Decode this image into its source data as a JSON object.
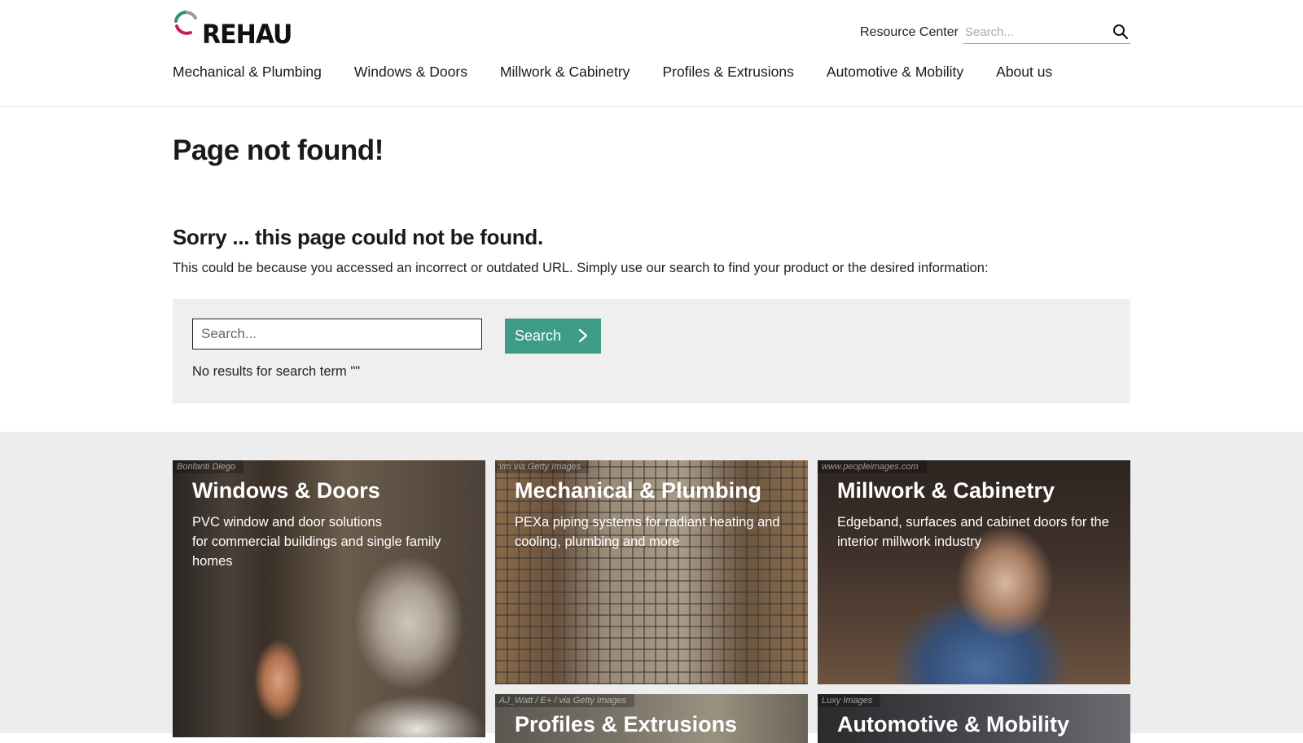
{
  "brand": {
    "name": "REHAU"
  },
  "header": {
    "resource_link": "Resource Center",
    "search_placeholder": "Search...",
    "nav": [
      "Mechanical & Plumbing",
      "Windows & Doors",
      "Millwork & Cabinetry",
      "Profiles & Extrusions",
      "Automotive & Mobility",
      "About us"
    ]
  },
  "main": {
    "title": "Page not found!",
    "sorry_heading": "Sorry ... this page could not be found.",
    "description": "This could be because you accessed an incorrect or outdated URL. Simply use our search to find your product or the desired information:",
    "search": {
      "placeholder": "Search...",
      "button_label": "Search",
      "no_results": "No results for search term \"\""
    }
  },
  "cards": [
    {
      "title": "Windows & Doors",
      "text": "PVC window and door solutions\nfor commercial buildings and single family homes",
      "credit": "Bonfanti Diego"
    },
    {
      "title": "Mechanical & Plumbing",
      "text": "PEXa piping systems for radiant heating and cooling, plumbing and more",
      "credit": "vm via Getty Images"
    },
    {
      "title": "Millwork & Cabinetry",
      "text": "Edgeband, surfaces and cabinet doors for the interior millwork industry",
      "credit": "www.peopleimages.com"
    },
    {
      "title": "Profiles & Extrusions",
      "text": "",
      "credit": "AJ_Watt / E+ / via Getty Images"
    },
    {
      "title": "Automotive & Mobility",
      "text": "",
      "credit": "Luxy Images"
    }
  ],
  "colors": {
    "accent": "#3d9b88",
    "panel": "#efefef",
    "cards_background": "#ededed"
  },
  "icons": {
    "search": "search-icon",
    "chevron": "chevron-right-icon"
  }
}
